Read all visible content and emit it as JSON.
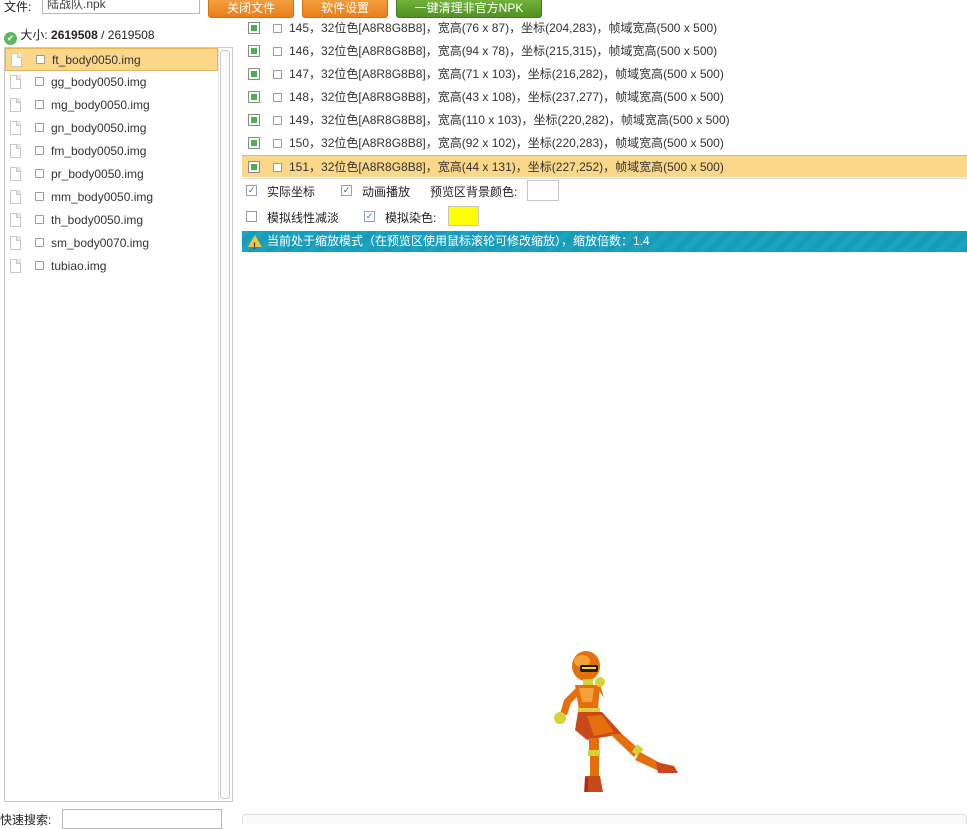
{
  "toolbar": {
    "file_label": "文件:",
    "file_value": "陆战队.npk",
    "close_file_label": "关闭文件",
    "settings_label": "软件设置",
    "clean_label": "一键清理非官方NPK"
  },
  "size": {
    "label": "大小:",
    "current": "2619508",
    "separator": "/",
    "total": "2619508"
  },
  "img_list": [
    {
      "name": "ft_body0050.img",
      "selected": true
    },
    {
      "name": "gg_body0050.img",
      "selected": false
    },
    {
      "name": "mg_body0050.img",
      "selected": false
    },
    {
      "name": "gn_body0050.img",
      "selected": false
    },
    {
      "name": "fm_body0050.img",
      "selected": false
    },
    {
      "name": "pr_body0050.img",
      "selected": false
    },
    {
      "name": "mm_body0050.img",
      "selected": false
    },
    {
      "name": "th_body0050.img",
      "selected": false
    },
    {
      "name": "sm_body0070.img",
      "selected": false
    },
    {
      "name": "tubiao.img",
      "selected": false
    }
  ],
  "search": {
    "label": "快速搜索:",
    "value": ""
  },
  "frames": [
    {
      "text": "145，32位色[A8R8G8B8]，宽高(76 x 87)，坐标(204,283)，帧域宽高(500 x 500)",
      "selected": false
    },
    {
      "text": "146，32位色[A8R8G8B8]，宽高(94 x 78)，坐标(215,315)，帧域宽高(500 x 500)",
      "selected": false
    },
    {
      "text": "147，32位色[A8R8G8B8]，宽高(71 x 103)，坐标(216,282)，帧域宽高(500 x 500)",
      "selected": false
    },
    {
      "text": "148，32位色[A8R8G8B8]，宽高(43 x 108)，坐标(237,277)，帧域宽高(500 x 500)",
      "selected": false
    },
    {
      "text": "149，32位色[A8R8G8B8]，宽高(110 x 103)，坐标(220,282)，帧域宽高(500 x 500)",
      "selected": false
    },
    {
      "text": "150，32位色[A8R8G8B8]，宽高(92 x 102)，坐标(220,283)，帧域宽高(500 x 500)",
      "selected": false
    },
    {
      "text": "151，32位色[A8R8G8B8]，宽高(44 x 131)，坐标(227,252)，帧域宽高(500 x 500)",
      "selected": true
    }
  ],
  "options": {
    "actual_coords_label": "实际坐标",
    "actual_coords_checked": true,
    "anim_play_label": "动画播放",
    "anim_play_checked": true,
    "bg_color_label": "预览区背景颜色:",
    "bg_color": "#ffffff",
    "linear_fade_label": "模拟线性减淡",
    "linear_fade_checked": false,
    "dye_label": "模拟染色:",
    "dye_checked": true,
    "dye_color": "#ffff00"
  },
  "notice": {
    "text": "当前处于缩放模式（在预览区使用鼠标滚轮可修改缩放），缩放倍数：1.4"
  },
  "colors": {
    "accent_orange": "#e8801a",
    "accent_green": "#4f9322",
    "selection": "#fbd789",
    "notice_bg": "#1ea3bf"
  }
}
